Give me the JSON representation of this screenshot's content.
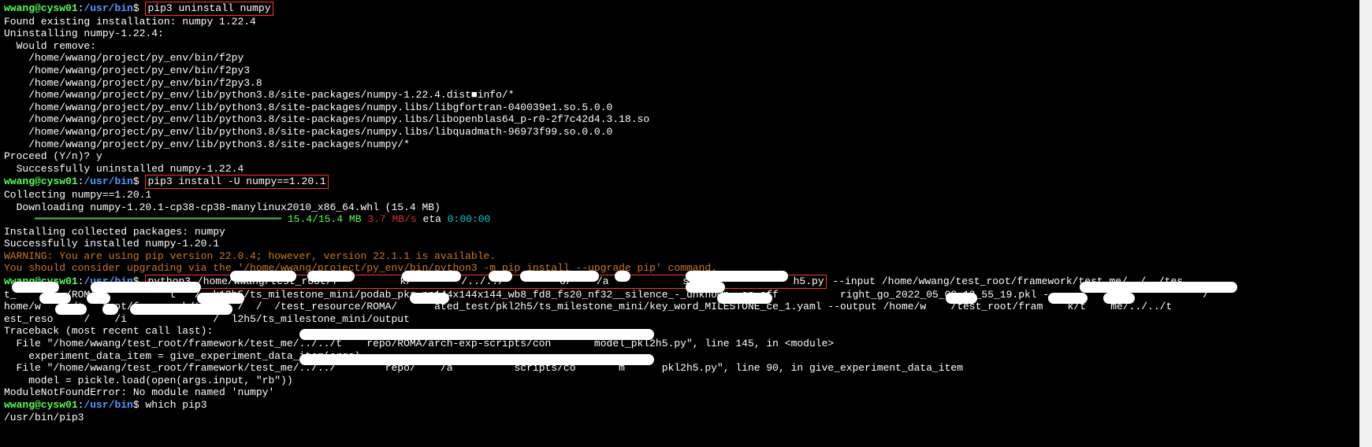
{
  "prompt": {
    "user": "wwang@cysw01",
    "sep": ":",
    "path": "/usr/bin",
    "dollar": "$"
  },
  "cmd1": "pip3 uninstall numpy",
  "out1": [
    "Found existing installation: numpy 1.22.4",
    "Uninstalling numpy-1.22.4:",
    "  Would remove:",
    "    /home/wwang/project/py_env/bin/f2py",
    "    /home/wwang/project/py_env/bin/f2py3",
    "    /home/wwang/project/py_env/bin/f2py3.8",
    "    /home/wwang/project/py_env/lib/python3.8/site-packages/numpy-1.22.4.dist■info/*",
    "    /home/wwang/project/py_env/lib/python3.8/site-packages/numpy.libs/libgfortran-040039e1.so.5.0.0",
    "    /home/wwang/project/py_env/lib/python3.8/site-packages/numpy.libs/libopenblas64_p-r0-2f7c42d4.3.18.so",
    "    /home/wwang/project/py_env/lib/python3.8/site-packages/numpy.libs/libquadmath-96973f99.so.0.0.0",
    "    /home/wwang/project/py_env/lib/python3.8/site-packages/numpy/*",
    "Proceed (Y/n)? y",
    "  Successfully uninstalled numpy-1.22.4"
  ],
  "cmd2": "pip3 install -U numpy==1.20.1",
  "out2a": [
    "Collecting numpy==1.20.1",
    "  Downloading numpy-1.20.1-cp38-cp38-manylinux2010_x86_64.whl (15.4 MB)"
  ],
  "dlbar": "     ━━━━━━━━━━━━━━━━━━━━━━━━━━━━━━━━━━━━━━━━",
  "dlstats": {
    "size": " 15.4/15.4 MB",
    "speed": " 3.7 MB/s",
    "etalabel": " eta",
    "etaval": " 0:00:00"
  },
  "out2b": [
    "Installing collected packages: numpy",
    "Successfully installed numpy-1.20.1"
  ],
  "warn1": "WARNING: You are using pip version 22.0.4; however, version 22.1.1 is available.",
  "warn2": "You should consider upgrading via the '/home/wwang/project/py_env/bin/python3 -m pip install --upgrade pip' command.",
  "cmd3a": "python3 /home/wwang/test_root/f          k/        /../../         o/    /a            s/m               h5.py",
  "cmd3b": " --input /home/wwang/test_root/framework/test_me/../../tes",
  "out3": [
    "t_        /ROMA/i          t   /  k12h5/ts_milestone_mini/podab_pkr_nn144x144x144_wb8_fd8_fs20_nf32__silence_-_unknown_-on-off          right_go_2022_05_09_12_55_19.pkl -                         /",
    "home/w     /t   root/framework/t      /  /  /test_resource/ROMA/      ated_test/pkl2h5/ts_milestone_mini/key_word_MILESTONE_ce_1.yaml --output /home/w    /test_root/fram    k/t    me/../../t",
    "est_reso     /    /i              /  l2h5/ts_milestone_mini/output",
    "Traceback (most recent call last):",
    "  File \"/home/wwang/test_root/framework/test_me/../../t    repo/ROMA/arch-exp-scripts/con       model_pkl2h5.py\", line 145, in <module>",
    "    experiment_data_item = give_experiment_data_item(args)",
    "  File \"/home/wwang/test_root/framework/test_me/../../        repo/    /a          scripts/co       m      pkl2h5.py\", line 90, in give_experiment_data_item",
    "    model = pickle.load(open(args.input, \"rb\"))",
    "ModuleNotFoundError: No module named 'numpy'"
  ],
  "cmd4": "which pip3",
  "out4": "/usr/bin/pip3"
}
